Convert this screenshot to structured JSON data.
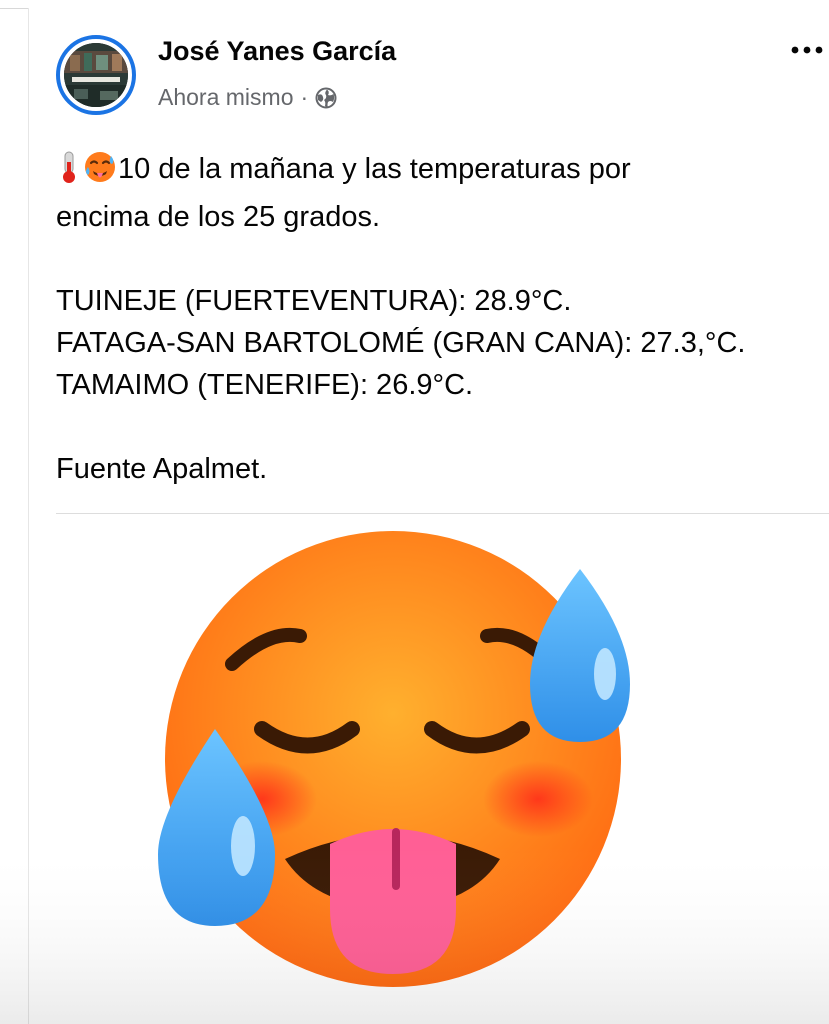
{
  "post": {
    "author": "José Yanes García",
    "timestamp": "Ahora mismo",
    "separator": "·",
    "audience_icon": "globe-icon",
    "more_icon": "more-options-icon",
    "lead_emojis": [
      "thermometer-emoji",
      "hot-face-emoji"
    ],
    "lines": {
      "intro_1": "10 de la mañana y las temperaturas por",
      "intro_2": "encima de los 25 grados.",
      "reading_1": "TUINEJE (FUERTEVENTURA): 28.9°C.",
      "reading_2": "FATAGA-SAN BARTOLOMÉ (GRAN CANA): 27.3,°C.",
      "reading_3": "TAMAIMO (TENERIFE): 26.9°C.",
      "source": "Fuente Apalmet."
    },
    "media": {
      "subject": "hot-face-emoji-large"
    }
  },
  "colors": {
    "avatar_ring": "#1b74e4",
    "meta_text": "#65676b",
    "emoji_face": "#ff8a1f",
    "emoji_tongue": "#ff6fa0",
    "sweat_drop": "#4fb3f5"
  }
}
